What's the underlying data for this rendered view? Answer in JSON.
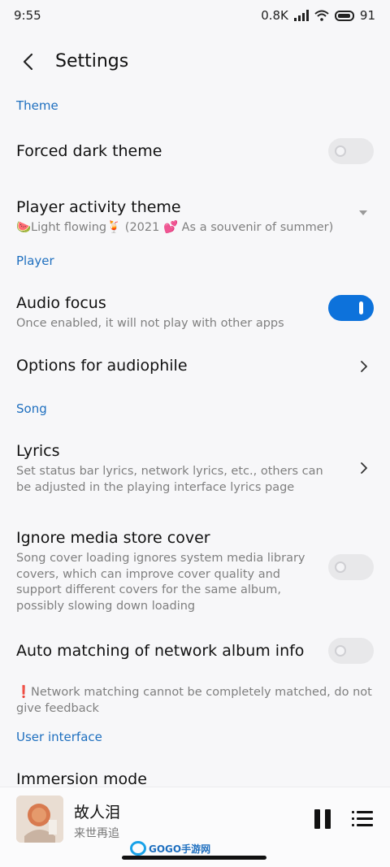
{
  "status": {
    "time": "9:55",
    "speed": "0.8K",
    "battery": "91"
  },
  "header": {
    "title": "Settings"
  },
  "sections": {
    "theme": "Theme",
    "player": "Player",
    "song": "Song",
    "ui": "User interface"
  },
  "settings": {
    "forced_dark": {
      "title": "Forced dark theme",
      "enabled": false
    },
    "player_theme": {
      "title": "Player activity theme",
      "value": "🍉Light flowing🍹 (2021 💕 As a souvenir of summer)"
    },
    "audio_focus": {
      "title": "Audio focus",
      "subtitle": "Once enabled, it will not play with other apps",
      "enabled": true
    },
    "audiophile": {
      "title": "Options for audiophile"
    },
    "lyrics": {
      "title": "Lyrics",
      "subtitle": "Set status bar lyrics, network lyrics, etc., others can be adjusted in the playing interface lyrics page"
    },
    "ignore_cover": {
      "title": "Ignore media store cover",
      "subtitle": "Song cover loading ignores system media library covers, which can improve cover quality and support different covers for the same album, possibly slowing down loading",
      "enabled": false
    },
    "auto_match": {
      "title": "Auto matching of network album info",
      "enabled": false
    },
    "network_note": "❗Network matching cannot be completely matched, do not give feedback",
    "immersion": {
      "title": "Immersion mode"
    }
  },
  "player": {
    "song": "故人泪",
    "artist": "来世再追"
  },
  "watermark": {
    "text": "GOGO手游网"
  },
  "icons": {
    "back": "back-arrow-icon",
    "chevron": "chevron-right-icon",
    "dropdown": "dropdown-triangle-icon",
    "pause": "pause-icon",
    "queue": "playlist-icon"
  },
  "colors": {
    "accent": "#0d72db",
    "section": "#1e6fbf",
    "background": "#f7f7f9"
  }
}
